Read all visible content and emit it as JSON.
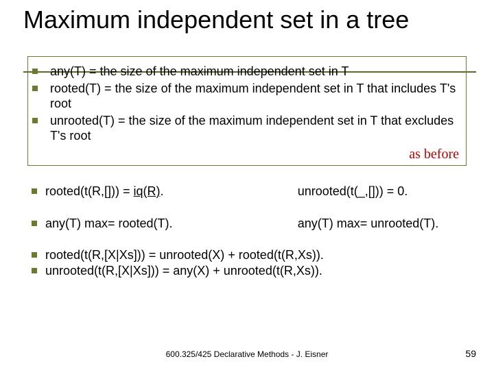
{
  "title": "Maximum independent set in a tree",
  "box": {
    "items": [
      "any(T) = the size of the maximum independent set in T",
      "rooted(T) = the size of the maximum independent set in T that includes T's root",
      "unrooted(T) = the size of the maximum independent set in T that excludes T's root"
    ],
    "note": "as before"
  },
  "rows": [
    {
      "left_prefix": "rooted(t(R,[])) = ",
      "left_iq": "iq(R)",
      "left_suffix": ".",
      "right": "unrooted(t(_,[])) = 0."
    },
    {
      "left": "any(T) max= rooted(T).",
      "right": "any(T) max= unrooted(T)."
    }
  ],
  "tail": [
    "rooted(t(R,[X|Xs])) = unrooted(X) + rooted(t(R,Xs)).",
    "unrooted(t(R,[X|Xs])) = any(X) + unrooted(t(R,Xs))."
  ],
  "footer": "600.325/425 Declarative Methods - J. Eisner",
  "page": "59"
}
